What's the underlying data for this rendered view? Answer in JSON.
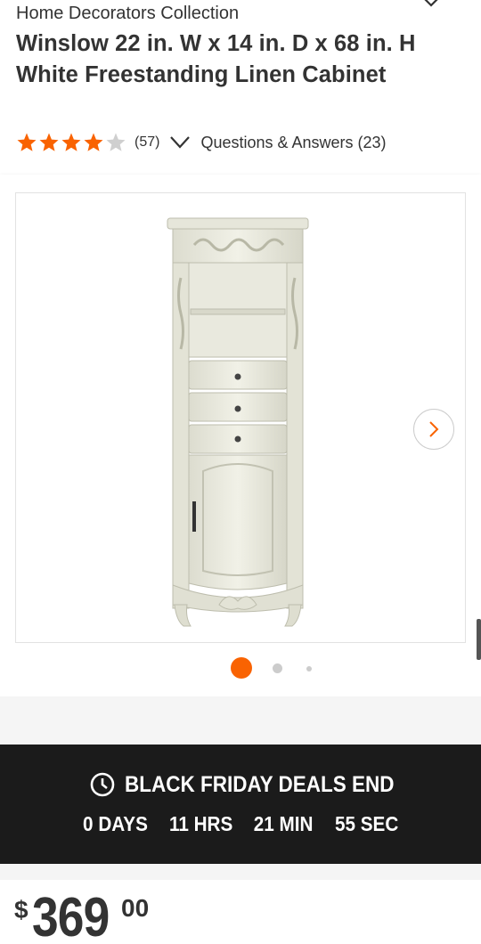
{
  "product": {
    "brand": "Home Decorators Collection",
    "title": "Winslow 22 in. W x 14 in. D x 68 in. H White Freestanding Linen Cabinet",
    "rating": 4,
    "rating_max": 5,
    "review_count": "(57)",
    "qa_link": "Questions & Answers (23)"
  },
  "gallery": {
    "image_subject": "white freestanding linen cabinet",
    "next_icon": "chevron-right-icon",
    "pages": 3,
    "active_page": 1
  },
  "deal": {
    "title": "BLACK FRIDAY DEALS END",
    "icon": "clock-icon",
    "countdown": {
      "days": "0 DAYS",
      "hours": "11 HRS",
      "minutes": "21 MIN",
      "seconds": "55 SEC"
    }
  },
  "price": {
    "dollar_sign": "$",
    "whole": "369",
    "cents": "00"
  },
  "colors": {
    "accent": "#f96302",
    "star": "#f96302",
    "banner": "#1b1b1b"
  }
}
